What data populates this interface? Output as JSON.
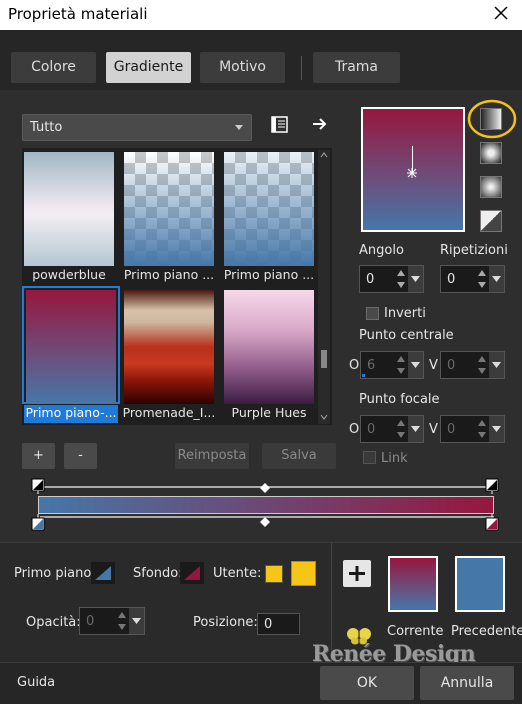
{
  "window": {
    "title": "Proprietà materiali"
  },
  "tabs": [
    {
      "label": "Colore"
    },
    {
      "label": "Gradiente"
    },
    {
      "label": "Motivo"
    },
    {
      "label": "Trama"
    }
  ],
  "gradient_category": {
    "selected": "Tutto"
  },
  "gradients": [
    {
      "label": "powderblue"
    },
    {
      "label": "Primo piano ..."
    },
    {
      "label": "Primo piano ..."
    },
    {
      "label": "Primo piano-..."
    },
    {
      "label": "Promenade_I..."
    },
    {
      "label": "Purple Hues"
    }
  ],
  "list_buttons": {
    "add": "+",
    "remove": "-",
    "reset": "Reimposta",
    "save": "Salva"
  },
  "angle": {
    "label": "Angolo",
    "value": "0"
  },
  "repeats": {
    "label": "Ripetizioni",
    "value": "0"
  },
  "invert": {
    "label": "Inverti"
  },
  "center_point": {
    "label": "Punto centrale",
    "h_label": "O",
    "h_value": "6",
    "v_label": "V",
    "v_value": "0"
  },
  "focal_point": {
    "label": "Punto focale",
    "h_label": "O",
    "h_value": "0",
    "v_label": "V",
    "v_value": "0"
  },
  "link": {
    "label": "Link"
  },
  "bottom": {
    "foreground_label": "Primo piano:",
    "background_label": "Sfondo:",
    "user_label": "Utente:",
    "opacity_label": "Opacità:",
    "opacity_value": "0",
    "position_label": "Posizione:",
    "position_value": "0",
    "current_label": "Corrente",
    "previous_label": "Precedente"
  },
  "footer": {
    "help": "Guida",
    "ok": "OK",
    "cancel": "Annulla"
  },
  "watermark": "Renée Design",
  "colors": {
    "gradient_top": "#96173e",
    "gradient_bottom": "#4577a8",
    "previous_color": "#4577a8",
    "user_color": "#f5c518",
    "selection": "#1f7ad8",
    "highlight_ring": "#f2c21b"
  }
}
